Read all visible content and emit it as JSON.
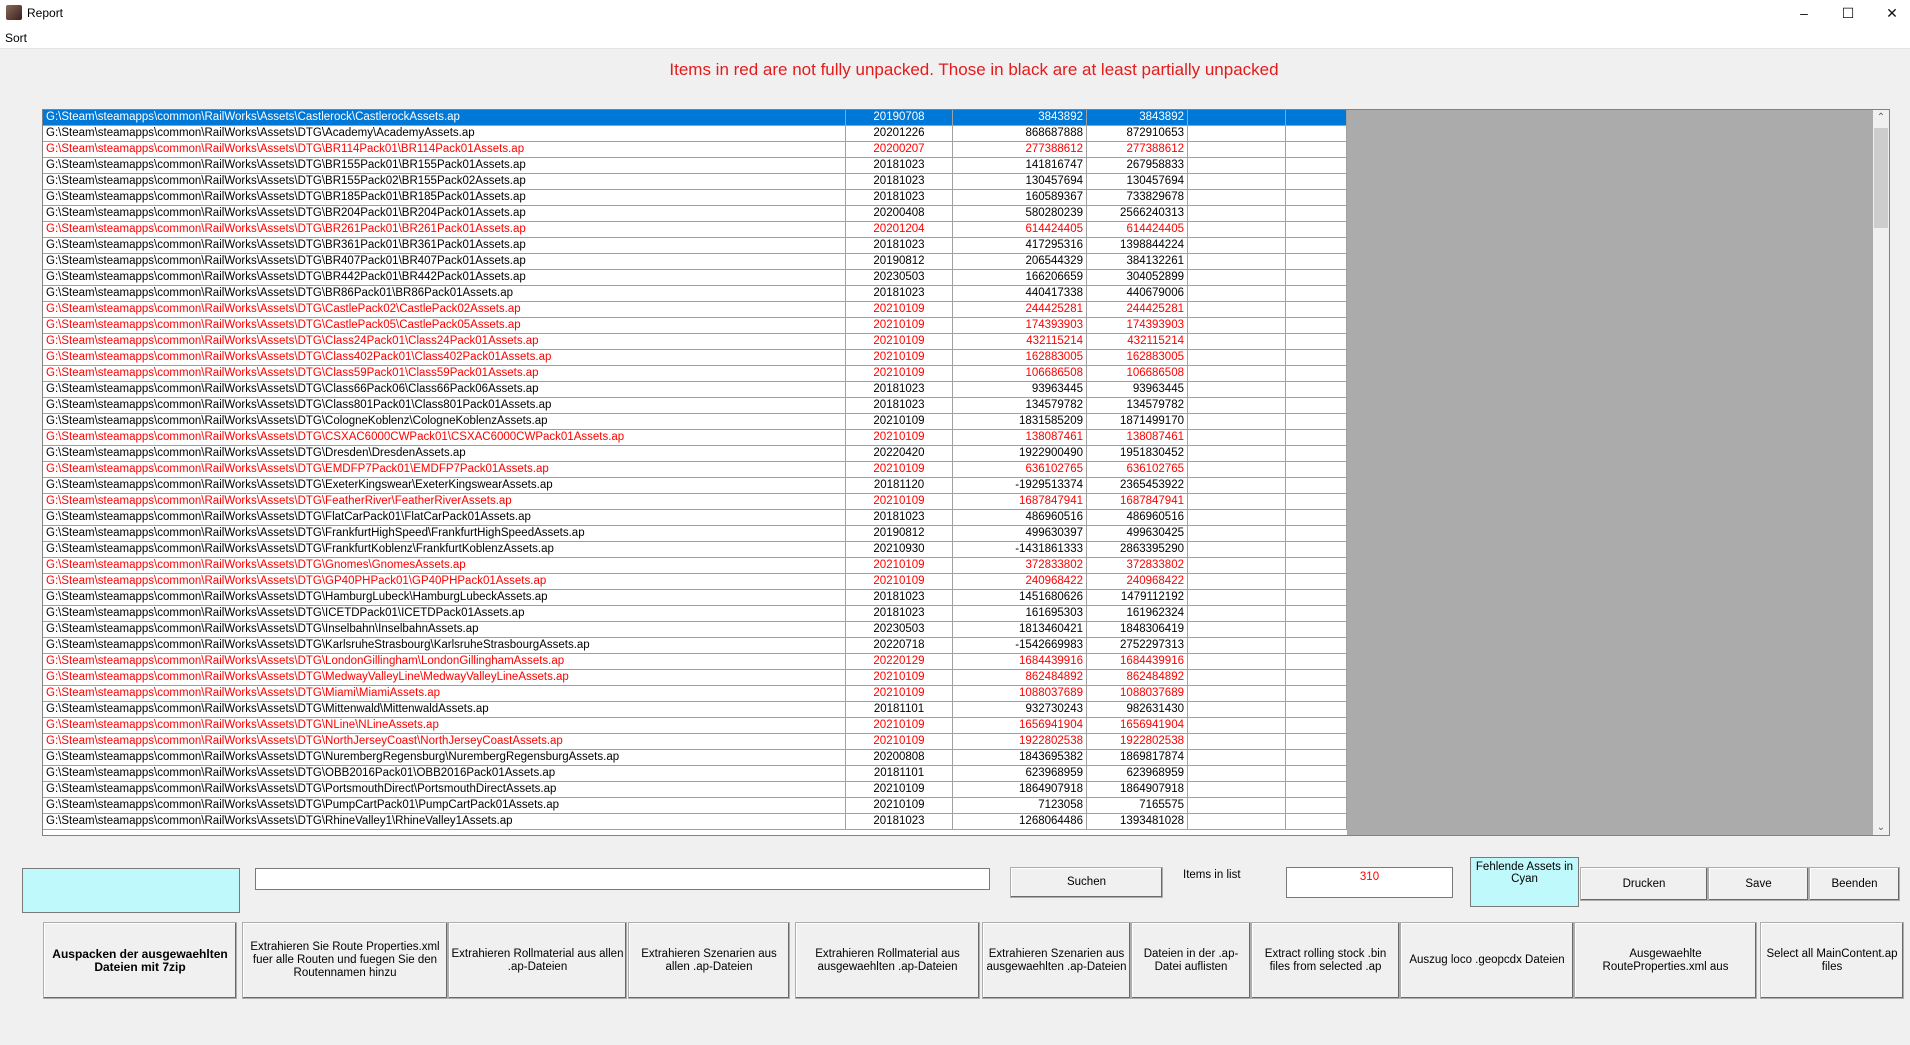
{
  "window": {
    "title": "Report",
    "menu": [
      "Sort"
    ]
  },
  "message": "Items in red are not fully unpacked. Those in black are at least partially unpacked",
  "colors": {
    "not_unpacked": "#ff0000",
    "selected": "#0078d7",
    "cyan": "#bff9fb"
  },
  "list": {
    "rows": [
      {
        "path": "G:\\Steam\\steamapps\\common\\RailWorks\\Assets\\Castlerock\\CastlerockAssets.ap",
        "date": "20190708",
        "size1": "3843892",
        "size2": "3843892",
        "red": false,
        "selected": true
      },
      {
        "path": "G:\\Steam\\steamapps\\common\\RailWorks\\Assets\\DTG\\Academy\\AcademyAssets.ap",
        "date": "20201226",
        "size1": "868687888",
        "size2": "872910653",
        "red": false
      },
      {
        "path": "G:\\Steam\\steamapps\\common\\RailWorks\\Assets\\DTG\\BR114Pack01\\BR114Pack01Assets.ap",
        "date": "20200207",
        "size1": "277388612",
        "size2": "277388612",
        "red": true
      },
      {
        "path": "G:\\Steam\\steamapps\\common\\RailWorks\\Assets\\DTG\\BR155Pack01\\BR155Pack01Assets.ap",
        "date": "20181023",
        "size1": "141816747",
        "size2": "267958833",
        "red": false
      },
      {
        "path": "G:\\Steam\\steamapps\\common\\RailWorks\\Assets\\DTG\\BR155Pack02\\BR155Pack02Assets.ap",
        "date": "20181023",
        "size1": "130457694",
        "size2": "130457694",
        "red": false
      },
      {
        "path": "G:\\Steam\\steamapps\\common\\RailWorks\\Assets\\DTG\\BR185Pack01\\BR185Pack01Assets.ap",
        "date": "20181023",
        "size1": "160589367",
        "size2": "733829678",
        "red": false
      },
      {
        "path": "G:\\Steam\\steamapps\\common\\RailWorks\\Assets\\DTG\\BR204Pack01\\BR204Pack01Assets.ap",
        "date": "20200408",
        "size1": "580280239",
        "size2": "2566240313",
        "red": false
      },
      {
        "path": "G:\\Steam\\steamapps\\common\\RailWorks\\Assets\\DTG\\BR261Pack01\\BR261Pack01Assets.ap",
        "date": "20201204",
        "size1": "614424405",
        "size2": "614424405",
        "red": true
      },
      {
        "path": "G:\\Steam\\steamapps\\common\\RailWorks\\Assets\\DTG\\BR361Pack01\\BR361Pack01Assets.ap",
        "date": "20181023",
        "size1": "417295316",
        "size2": "1398844224",
        "red": false
      },
      {
        "path": "G:\\Steam\\steamapps\\common\\RailWorks\\Assets\\DTG\\BR407Pack01\\BR407Pack01Assets.ap",
        "date": "20190812",
        "size1": "206544329",
        "size2": "384132261",
        "red": false
      },
      {
        "path": "G:\\Steam\\steamapps\\common\\RailWorks\\Assets\\DTG\\BR442Pack01\\BR442Pack01Assets.ap",
        "date": "20230503",
        "size1": "166206659",
        "size2": "304052899",
        "red": false
      },
      {
        "path": "G:\\Steam\\steamapps\\common\\RailWorks\\Assets\\DTG\\BR86Pack01\\BR86Pack01Assets.ap",
        "date": "20181023",
        "size1": "440417338",
        "size2": "440679006",
        "red": false
      },
      {
        "path": "G:\\Steam\\steamapps\\common\\RailWorks\\Assets\\DTG\\CastlePack02\\CastlePack02Assets.ap",
        "date": "20210109",
        "size1": "244425281",
        "size2": "244425281",
        "red": true
      },
      {
        "path": "G:\\Steam\\steamapps\\common\\RailWorks\\Assets\\DTG\\CastlePack05\\CastlePack05Assets.ap",
        "date": "20210109",
        "size1": "174393903",
        "size2": "174393903",
        "red": true
      },
      {
        "path": "G:\\Steam\\steamapps\\common\\RailWorks\\Assets\\DTG\\Class24Pack01\\Class24Pack01Assets.ap",
        "date": "20210109",
        "size1": "432115214",
        "size2": "432115214",
        "red": true
      },
      {
        "path": "G:\\Steam\\steamapps\\common\\RailWorks\\Assets\\DTG\\Class402Pack01\\Class402Pack01Assets.ap",
        "date": "20210109",
        "size1": "162883005",
        "size2": "162883005",
        "red": true
      },
      {
        "path": "G:\\Steam\\steamapps\\common\\RailWorks\\Assets\\DTG\\Class59Pack01\\Class59Pack01Assets.ap",
        "date": "20210109",
        "size1": "106686508",
        "size2": "106686508",
        "red": true
      },
      {
        "path": "G:\\Steam\\steamapps\\common\\RailWorks\\Assets\\DTG\\Class66Pack06\\Class66Pack06Assets.ap",
        "date": "20181023",
        "size1": "93963445",
        "size2": "93963445",
        "red": false
      },
      {
        "path": "G:\\Steam\\steamapps\\common\\RailWorks\\Assets\\DTG\\Class801Pack01\\Class801Pack01Assets.ap",
        "date": "20181023",
        "size1": "134579782",
        "size2": "134579782",
        "red": false
      },
      {
        "path": "G:\\Steam\\steamapps\\common\\RailWorks\\Assets\\DTG\\CologneKoblenz\\CologneKoblenzAssets.ap",
        "date": "20210109",
        "size1": "1831585209",
        "size2": "1871499170",
        "red": false
      },
      {
        "path": "G:\\Steam\\steamapps\\common\\RailWorks\\Assets\\DTG\\CSXAC6000CWPack01\\CSXAC6000CWPack01Assets.ap",
        "date": "20210109",
        "size1": "138087461",
        "size2": "138087461",
        "red": true
      },
      {
        "path": "G:\\Steam\\steamapps\\common\\RailWorks\\Assets\\DTG\\Dresden\\DresdenAssets.ap",
        "date": "20220420",
        "size1": "1922900490",
        "size2": "1951830452",
        "red": false
      },
      {
        "path": "G:\\Steam\\steamapps\\common\\RailWorks\\Assets\\DTG\\EMDFP7Pack01\\EMDFP7Pack01Assets.ap",
        "date": "20210109",
        "size1": "636102765",
        "size2": "636102765",
        "red": true
      },
      {
        "path": "G:\\Steam\\steamapps\\common\\RailWorks\\Assets\\DTG\\ExeterKingswear\\ExeterKingswearAssets.ap",
        "date": "20181120",
        "size1": "-1929513374",
        "size2": "2365453922",
        "red": false
      },
      {
        "path": "G:\\Steam\\steamapps\\common\\RailWorks\\Assets\\DTG\\FeatherRiver\\FeatherRiverAssets.ap",
        "date": "20210109",
        "size1": "1687847941",
        "size2": "1687847941",
        "red": true
      },
      {
        "path": "G:\\Steam\\steamapps\\common\\RailWorks\\Assets\\DTG\\FlatCarPack01\\FlatCarPack01Assets.ap",
        "date": "20181023",
        "size1": "486960516",
        "size2": "486960516",
        "red": false
      },
      {
        "path": "G:\\Steam\\steamapps\\common\\RailWorks\\Assets\\DTG\\FrankfurtHighSpeed\\FrankfurtHighSpeedAssets.ap",
        "date": "20190812",
        "size1": "499630397",
        "size2": "499630425",
        "red": false
      },
      {
        "path": "G:\\Steam\\steamapps\\common\\RailWorks\\Assets\\DTG\\FrankfurtKoblenz\\FrankfurtKoblenzAssets.ap",
        "date": "20210930",
        "size1": "-1431861333",
        "size2": "2863395290",
        "red": false
      },
      {
        "path": "G:\\Steam\\steamapps\\common\\RailWorks\\Assets\\DTG\\Gnomes\\GnomesAssets.ap",
        "date": "20210109",
        "size1": "372833802",
        "size2": "372833802",
        "red": true
      },
      {
        "path": "G:\\Steam\\steamapps\\common\\RailWorks\\Assets\\DTG\\GP40PHPack01\\GP40PHPack01Assets.ap",
        "date": "20210109",
        "size1": "240968422",
        "size2": "240968422",
        "red": true
      },
      {
        "path": "G:\\Steam\\steamapps\\common\\RailWorks\\Assets\\DTG\\HamburgLubeck\\HamburgLubeckAssets.ap",
        "date": "20181023",
        "size1": "1451680626",
        "size2": "1479112192",
        "red": false
      },
      {
        "path": "G:\\Steam\\steamapps\\common\\RailWorks\\Assets\\DTG\\ICETDPack01\\ICETDPack01Assets.ap",
        "date": "20181023",
        "size1": "161695303",
        "size2": "161962324",
        "red": false
      },
      {
        "path": "G:\\Steam\\steamapps\\common\\RailWorks\\Assets\\DTG\\Inselbahn\\InselbahnAssets.ap",
        "date": "20230503",
        "size1": "1813460421",
        "size2": "1848306419",
        "red": false
      },
      {
        "path": "G:\\Steam\\steamapps\\common\\RailWorks\\Assets\\DTG\\KarlsruheStrasbourg\\KarlsruheStrasbourgAssets.ap",
        "date": "20220718",
        "size1": "-1542669983",
        "size2": "2752297313",
        "red": false
      },
      {
        "path": "G:\\Steam\\steamapps\\common\\RailWorks\\Assets\\DTG\\LondonGillingham\\LondonGillinghamAssets.ap",
        "date": "20220129",
        "size1": "1684439916",
        "size2": "1684439916",
        "red": true
      },
      {
        "path": "G:\\Steam\\steamapps\\common\\RailWorks\\Assets\\DTG\\MedwayValleyLine\\MedwayValleyLineAssets.ap",
        "date": "20210109",
        "size1": "862484892",
        "size2": "862484892",
        "red": true
      },
      {
        "path": "G:\\Steam\\steamapps\\common\\RailWorks\\Assets\\DTG\\Miami\\MiamiAssets.ap",
        "date": "20210109",
        "size1": "1088037689",
        "size2": "1088037689",
        "red": true
      },
      {
        "path": "G:\\Steam\\steamapps\\common\\RailWorks\\Assets\\DTG\\Mittenwald\\MittenwaldAssets.ap",
        "date": "20181101",
        "size1": "932730243",
        "size2": "982631430",
        "red": false
      },
      {
        "path": "G:\\Steam\\steamapps\\common\\RailWorks\\Assets\\DTG\\NLine\\NLineAssets.ap",
        "date": "20210109",
        "size1": "1656941904",
        "size2": "1656941904",
        "red": true
      },
      {
        "path": "G:\\Steam\\steamapps\\common\\RailWorks\\Assets\\DTG\\NorthJerseyCoast\\NorthJerseyCoastAssets.ap",
        "date": "20210109",
        "size1": "1922802538",
        "size2": "1922802538",
        "red": true
      },
      {
        "path": "G:\\Steam\\steamapps\\common\\RailWorks\\Assets\\DTG\\NurembergRegensburg\\NurembergRegensburgAssets.ap",
        "date": "20200808",
        "size1": "1843695382",
        "size2": "1869817874",
        "red": false
      },
      {
        "path": "G:\\Steam\\steamapps\\common\\RailWorks\\Assets\\DTG\\OBB2016Pack01\\OBB2016Pack01Assets.ap",
        "date": "20181101",
        "size1": "623968959",
        "size2": "623968959",
        "red": false
      },
      {
        "path": "G:\\Steam\\steamapps\\common\\RailWorks\\Assets\\DTG\\PortsmouthDirect\\PortsmouthDirectAssets.ap",
        "date": "20210109",
        "size1": "1864907918",
        "size2": "1864907918",
        "red": false
      },
      {
        "path": "G:\\Steam\\steamapps\\common\\RailWorks\\Assets\\DTG\\PumpCartPack01\\PumpCartPack01Assets.ap",
        "date": "20210109",
        "size1": "7123058",
        "size2": "7165575",
        "red": false
      },
      {
        "path": "G:\\Steam\\steamapps\\common\\RailWorks\\Assets\\DTG\\RhineValley1\\RhineValley1Assets.ap",
        "date": "20181023",
        "size1": "1268064486",
        "size2": "1393481028",
        "red": false
      }
    ]
  },
  "controls": {
    "search_value": "",
    "search_label": "Suchen",
    "items_label": "Items in list",
    "items_count": "310",
    "missing_label": "Fehlende Assets in Cyan",
    "print_label": "Drucken",
    "save_label": "Save",
    "quit_label": "Beenden"
  },
  "actions": [
    "Auspacken der ausgewaehlten Dateien mit 7zip",
    "Extrahieren Sie Route Properties.xml fuer alle Routen und fuegen Sie den Routennamen hinzu",
    "Extrahieren Rollmaterial aus allen .ap-Dateien",
    "Extrahieren Szenarien aus allen .ap-Dateien",
    "Extrahieren Rollmaterial aus ausgewaehlten .ap-Dateien",
    "Extrahieren Szenarien aus ausgewaehlten .ap-Dateien",
    "Dateien in der .ap-Datei auflisten",
    "Extract rolling stock .bin files from selected .ap",
    "Auszug loco .geopcdx Dateien",
    "Ausgewaehlte RouteProperties.xml aus",
    "Select all MainContent.ap files"
  ]
}
